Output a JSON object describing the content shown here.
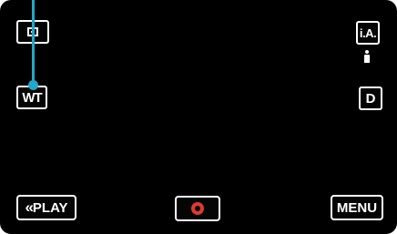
{
  "topbar": {
    "mode_icon": "camera-mode-icon",
    "ia_label": "i.A.",
    "person_icon": "person-icon"
  },
  "left": {
    "wt_label": "WT",
    "callout_color": "#1fa8c9"
  },
  "right": {
    "d_label": "D"
  },
  "bottom": {
    "play_chevron": "«",
    "play_label": "PLAY",
    "record_icon": "record-icon",
    "record_color": "#e03a2c",
    "menu_label": "MENU"
  }
}
